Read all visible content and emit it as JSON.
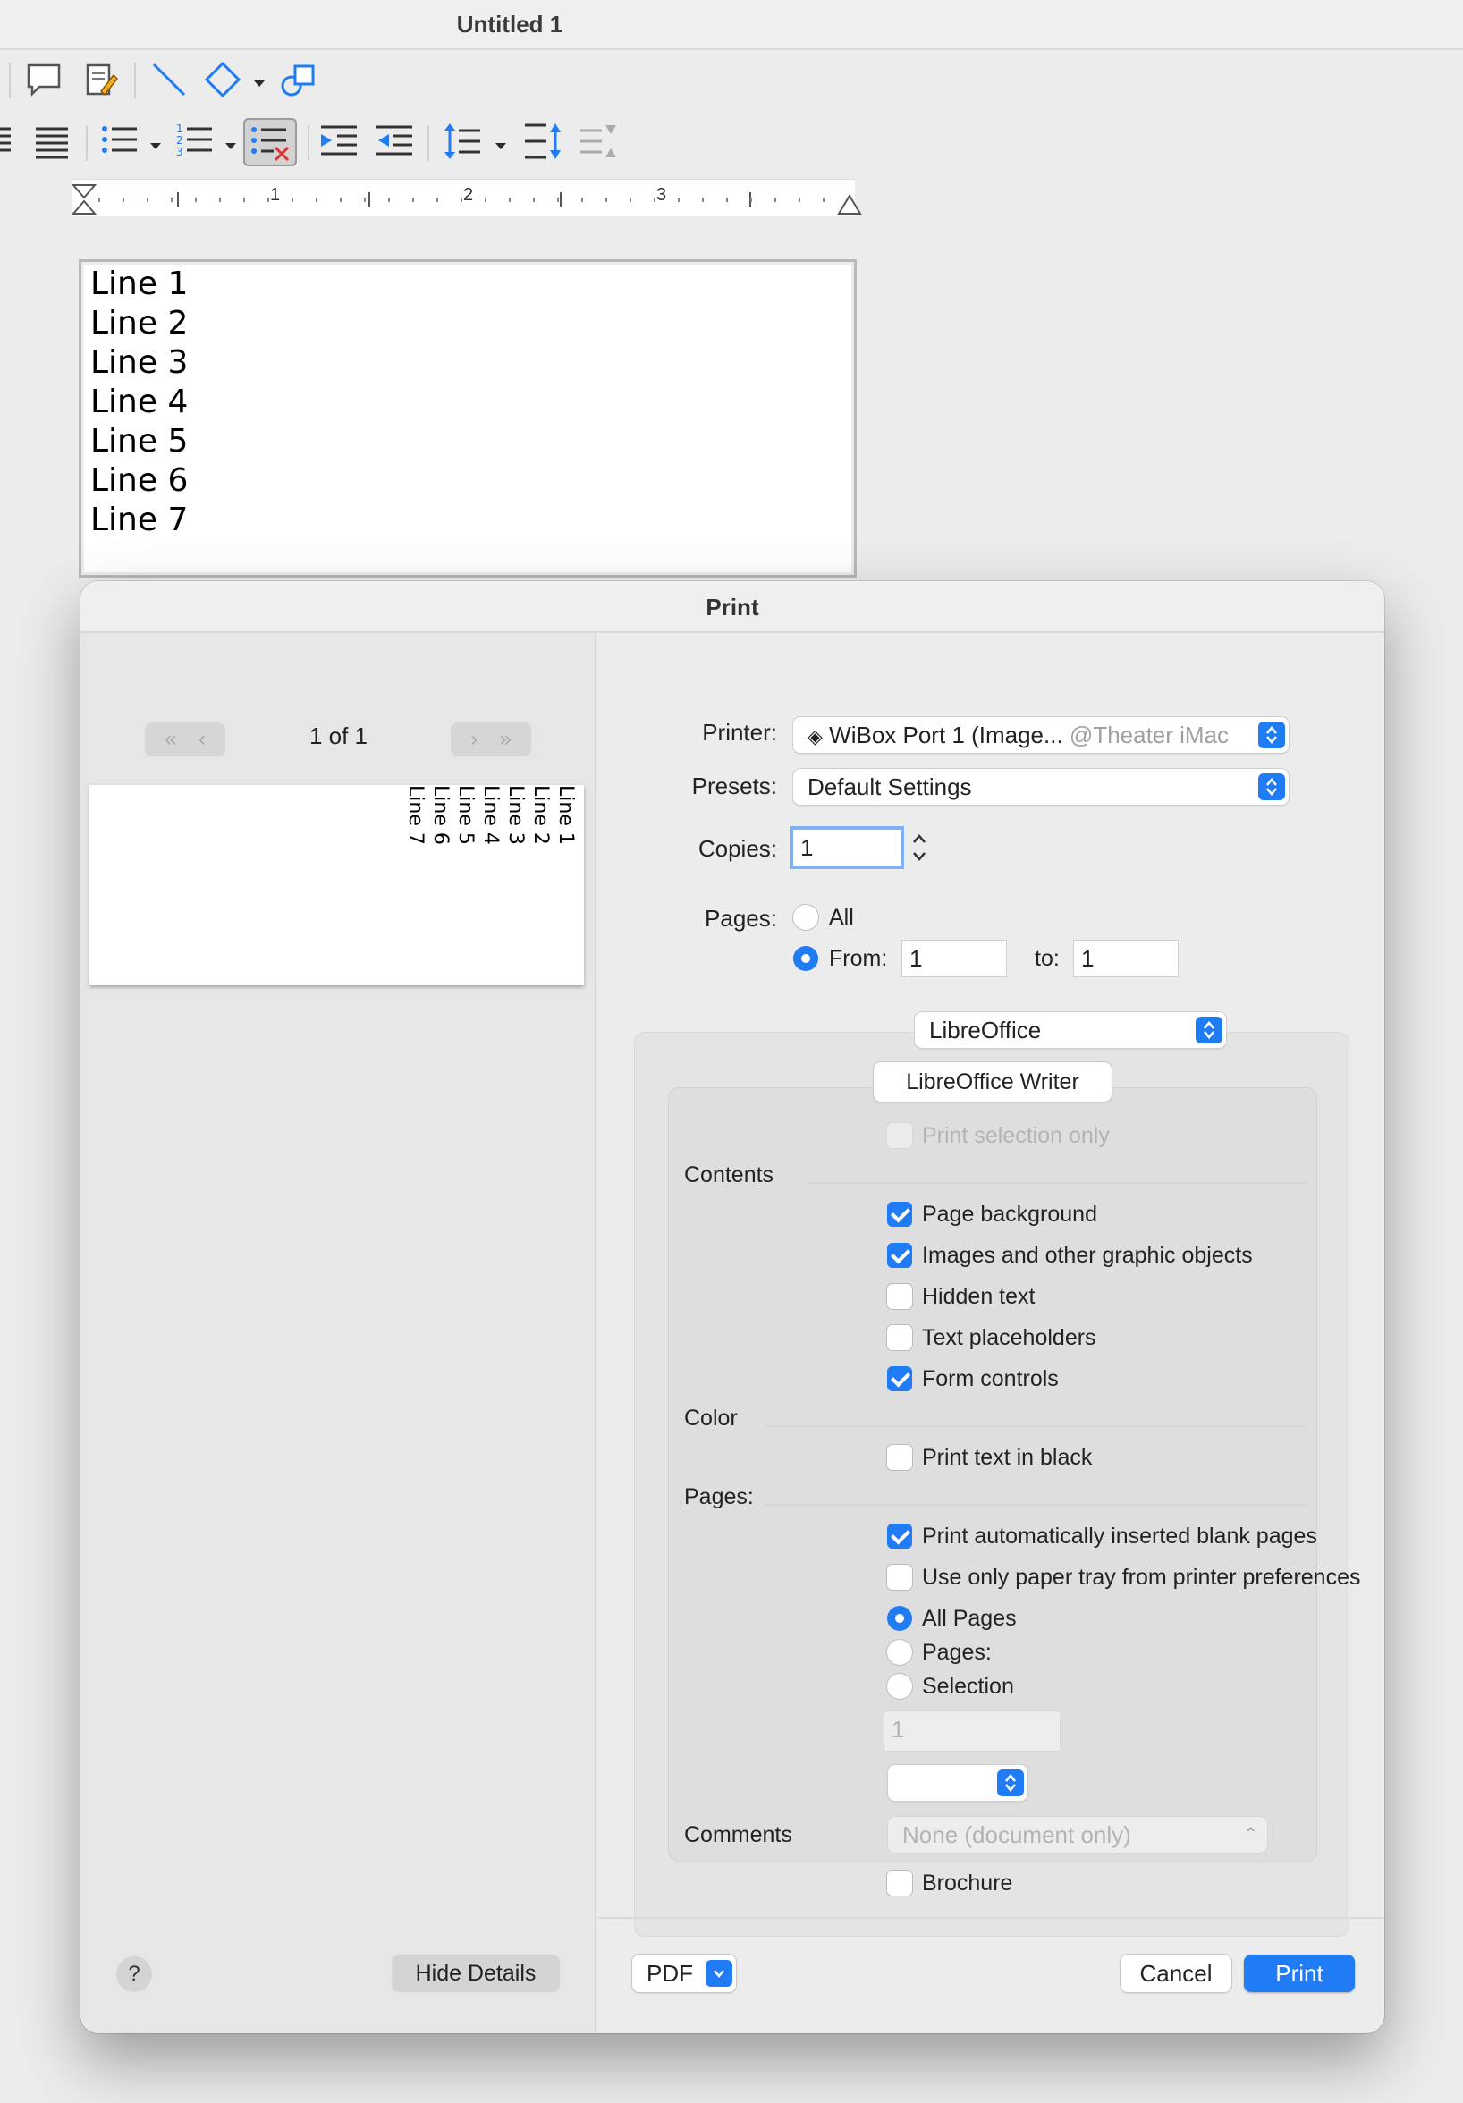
{
  "window": {
    "title": "Untitled 1"
  },
  "ruler": {
    "numbers": [
      "1",
      "2",
      "3"
    ]
  },
  "document": {
    "lines": [
      "Line 1",
      "Line 2",
      "Line 3",
      "Line 4",
      "Line 5",
      "Line 6",
      "Line 7"
    ]
  },
  "dialog": {
    "title": "Print",
    "preview": {
      "page_label": "1 of 1",
      "lines": [
        "Line 1",
        "Line 2",
        "Line 3",
        "Line 4",
        "Line 5",
        "Line 6",
        "Line 7"
      ]
    },
    "printer": {
      "label": "Printer:",
      "value": "WiBox Port 1 (Image...",
      "host": "@Theater iMac"
    },
    "presets": {
      "label": "Presets:",
      "value": "Default Settings"
    },
    "copies": {
      "label": "Copies:",
      "value": "1"
    },
    "pages": {
      "label": "Pages:",
      "all_label": "All",
      "from_label": "From:",
      "from_value": "1",
      "to_label": "to:",
      "to_value": "1",
      "selected": "from"
    },
    "section_popup": {
      "value": "LibreOffice"
    },
    "app_button": "LibreOffice Writer",
    "print_selection_only": {
      "label": "Print selection only",
      "checked": false,
      "enabled": false
    },
    "contents": {
      "heading": "Contents",
      "items": [
        {
          "label": "Page background",
          "checked": true
        },
        {
          "label": "Images and other graphic objects",
          "checked": true
        },
        {
          "label": "Hidden text",
          "checked": false
        },
        {
          "label": "Text placeholders",
          "checked": false
        },
        {
          "label": "Form controls",
          "checked": true
        }
      ]
    },
    "color": {
      "heading": "Color",
      "items": [
        {
          "label": "Print text in black",
          "checked": false
        }
      ]
    },
    "pages_section": {
      "heading": "Pages:",
      "checkboxes": [
        {
          "label": "Print automatically inserted blank pages",
          "checked": true
        },
        {
          "label": "Use only paper tray from printer preferences",
          "checked": false
        }
      ],
      "radios": [
        {
          "label": "All Pages",
          "selected": true
        },
        {
          "label": "Pages:",
          "selected": false
        },
        {
          "label": "Selection",
          "selected": false
        }
      ],
      "pages_field": "1"
    },
    "comments": {
      "label": "Comments",
      "value": "None (document only)"
    },
    "brochure": {
      "label": "Brochure",
      "checked": false
    },
    "buttons": {
      "help": "?",
      "hide_details": "Hide Details",
      "pdf": "PDF",
      "cancel": "Cancel",
      "print": "Print"
    }
  },
  "colors": {
    "accent": "#1f7cf5",
    "dialog_bg": "#ececec"
  }
}
